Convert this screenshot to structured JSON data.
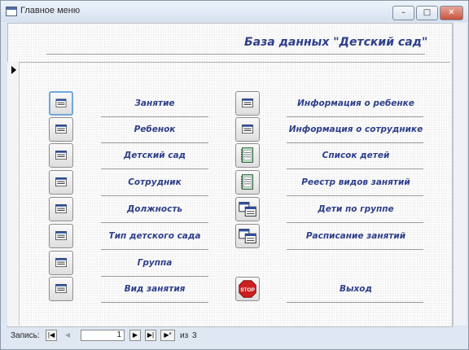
{
  "window": {
    "title": "Главное меню",
    "controls": {
      "minimize": "–",
      "maximize": "□",
      "close": "✕"
    }
  },
  "header": {
    "title": "База данных \"Детский сад\""
  },
  "left_items": [
    {
      "label": "Занятие",
      "icon": "form-icon"
    },
    {
      "label": "Ребенок",
      "icon": "form-icon"
    },
    {
      "label": "Детский сад",
      "icon": "form-icon"
    },
    {
      "label": "Сотрудник",
      "icon": "form-icon"
    },
    {
      "label": "Должность",
      "icon": "form-icon"
    },
    {
      "label": "Тип детского сада",
      "icon": "form-icon"
    },
    {
      "label": "Группа",
      "icon": "form-icon"
    },
    {
      "label": "Вид занятия",
      "icon": "form-icon"
    }
  ],
  "right_items": [
    {
      "label": "Информация о ребенке",
      "icon": "form-icon"
    },
    {
      "label": "Информация о сотруднике",
      "icon": "form-icon"
    },
    {
      "label": "Список детей",
      "icon": "report-icon"
    },
    {
      "label": "Реестр видов занятий",
      "icon": "report-icon"
    },
    {
      "label": "Дети по группе",
      "icon": "multi-form-icon"
    },
    {
      "label": "Расписание занятий",
      "icon": "multi-form-icon"
    },
    {
      "label": "Выход",
      "icon": "stop-icon"
    }
  ],
  "navigation": {
    "record_label": "Запись:",
    "current": "1",
    "of_label": "из",
    "total": "3",
    "buttons": {
      "first": "|◀",
      "prev": "◀",
      "next": "▶",
      "last": "▶|",
      "new": "▶*"
    }
  },
  "colors": {
    "label_text": "#2e3f8a",
    "stop_red": "#cc2020",
    "focus_border": "#6fa8dc"
  }
}
